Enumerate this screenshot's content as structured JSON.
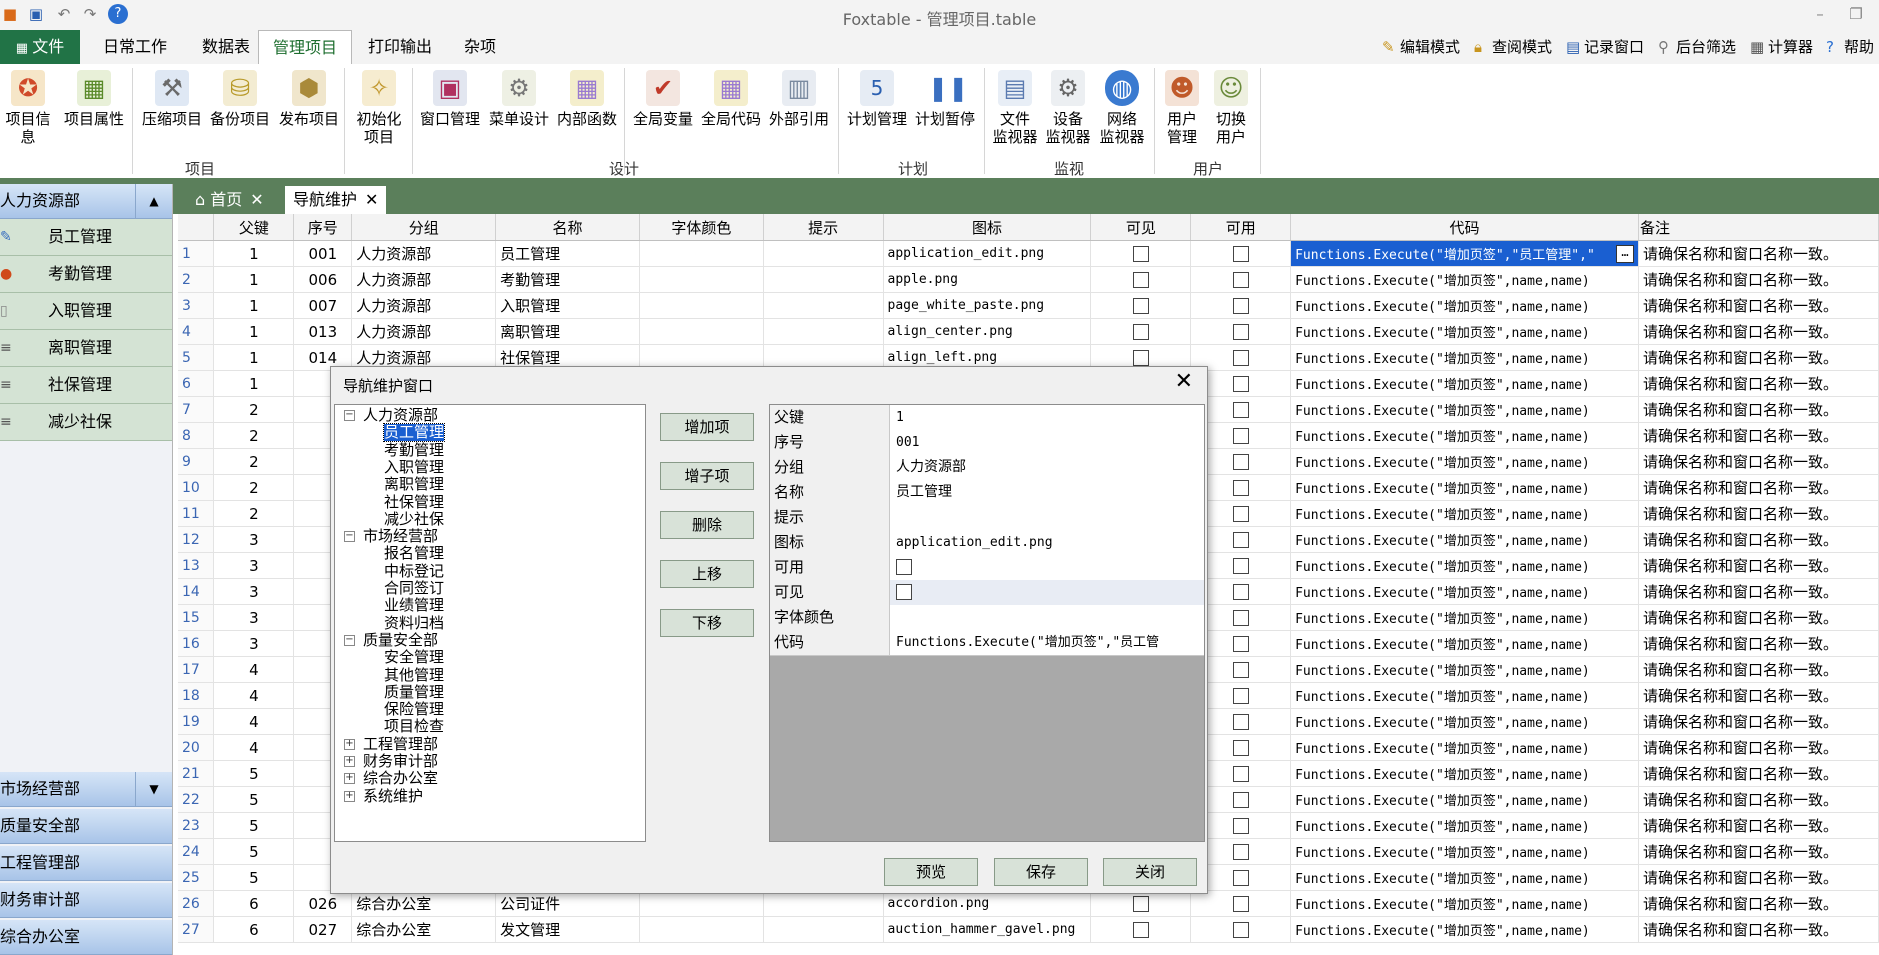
{
  "window": {
    "title": "Foxtable - 管理项目.table"
  },
  "ribbon_tabs": [
    {
      "label": "文件"
    },
    {
      "label": "日常工作"
    },
    {
      "label": "数据表"
    },
    {
      "label": "管理项目"
    },
    {
      "label": "打印输出"
    },
    {
      "label": "杂项"
    }
  ],
  "right_links": [
    {
      "label": "编辑模式",
      "icon": "pencil-icon"
    },
    {
      "label": "查阅模式",
      "icon": "lock-icon"
    },
    {
      "label": "记录窗口",
      "icon": "window-icon"
    },
    {
      "label": "后台筛选",
      "icon": "filter-icon"
    },
    {
      "label": "计算器",
      "icon": "calculator-icon"
    },
    {
      "label": "帮助",
      "icon": "help-icon"
    }
  ],
  "ribbon_groups": {
    "project": {
      "label": "项目",
      "buttons": [
        {
          "label": "项目信息"
        },
        {
          "label": "项目属性"
        },
        {
          "label": "压缩项目"
        },
        {
          "label": "备份项目"
        },
        {
          "label": "发布项目"
        },
        {
          "label1": "初始化",
          "label2": "项目"
        }
      ]
    },
    "design": {
      "label": "设计",
      "buttons": [
        {
          "label": "窗口管理"
        },
        {
          "label": "菜单设计"
        },
        {
          "label": "内部函数"
        },
        {
          "label": "全局变量"
        },
        {
          "label": "全局代码"
        },
        {
          "label": "外部引用"
        }
      ]
    },
    "plan": {
      "label": "计划",
      "buttons": [
        {
          "label": "计划管理"
        },
        {
          "label": "计划暂停"
        }
      ]
    },
    "monitor": {
      "label": "监视",
      "buttons": [
        {
          "label1": "文件",
          "label2": "监视器"
        },
        {
          "label1": "设备",
          "label2": "监视器"
        },
        {
          "label1": "网络",
          "label2": "监视器"
        }
      ]
    },
    "user": {
      "label": "用户",
      "buttons": [
        {
          "label1": "用户",
          "label2": "管理"
        },
        {
          "label1": "切换",
          "label2": "用户"
        }
      ]
    }
  },
  "left_nav": {
    "groups": [
      "人力资源部",
      "市场经营部",
      "质量安全部",
      "工程管理部",
      "财务审计部",
      "综合办公室"
    ],
    "items": [
      "员工管理",
      "考勤管理",
      "入职管理",
      "离职管理",
      "社保管理",
      "减少社保"
    ]
  },
  "doc_tabs": [
    {
      "label": "首页"
    },
    {
      "label": "导航维护"
    }
  ],
  "grid": {
    "columns": [
      "父键",
      "序号",
      "分组",
      "名称",
      "字体颜色",
      "提示",
      "图标",
      "可见",
      "可用",
      "代码",
      "备注"
    ],
    "selected_code": "Functions.Execute(\"增加页签\",\"员工管理\",\"",
    "default_code": "Functions.Execute(\"增加页签\",name,name)",
    "note": "请确保名称和窗口名称一致。",
    "rows": [
      {
        "n": "1",
        "pk": "1",
        "seq": "001",
        "group": "人力资源部",
        "name": "员工管理",
        "icon": "application_edit.png"
      },
      {
        "n": "2",
        "pk": "1",
        "seq": "006",
        "group": "人力资源部",
        "name": "考勤管理",
        "icon": "apple.png"
      },
      {
        "n": "3",
        "pk": "1",
        "seq": "007",
        "group": "人力资源部",
        "name": "入职管理",
        "icon": "page_white_paste.png"
      },
      {
        "n": "4",
        "pk": "1",
        "seq": "013",
        "group": "人力资源部",
        "name": "离职管理",
        "icon": "align_center.png"
      },
      {
        "n": "5",
        "pk": "1",
        "seq": "014",
        "group": "人力资源部",
        "name": "社保管理",
        "icon": "align_left.png"
      },
      {
        "n": "6",
        "pk": "1",
        "seq": "",
        "group": "",
        "name": "",
        "icon": ""
      },
      {
        "n": "7",
        "pk": "2",
        "seq": "",
        "group": "",
        "name": "",
        "icon": ""
      },
      {
        "n": "8",
        "pk": "2",
        "seq": "",
        "group": "",
        "name": "",
        "icon": ""
      },
      {
        "n": "9",
        "pk": "2",
        "seq": "",
        "group": "",
        "name": "",
        "icon": ""
      },
      {
        "n": "10",
        "pk": "2",
        "seq": "",
        "group": "",
        "name": "",
        "icon": ""
      },
      {
        "n": "11",
        "pk": "2",
        "seq": "",
        "group": "",
        "name": "",
        "icon": ""
      },
      {
        "n": "12",
        "pk": "3",
        "seq": "",
        "group": "",
        "name": "",
        "icon": ""
      },
      {
        "n": "13",
        "pk": "3",
        "seq": "",
        "group": "",
        "name": "",
        "icon": ""
      },
      {
        "n": "14",
        "pk": "3",
        "seq": "",
        "group": "",
        "name": "",
        "icon": ""
      },
      {
        "n": "15",
        "pk": "3",
        "seq": "",
        "group": "",
        "name": "",
        "icon": ""
      },
      {
        "n": "16",
        "pk": "3",
        "seq": "",
        "group": "",
        "name": "",
        "icon": ""
      },
      {
        "n": "17",
        "pk": "4",
        "seq": "",
        "group": "",
        "name": "",
        "icon": ""
      },
      {
        "n": "18",
        "pk": "4",
        "seq": "",
        "group": "",
        "name": "",
        "icon": ""
      },
      {
        "n": "19",
        "pk": "4",
        "seq": "",
        "group": "",
        "name": "",
        "icon": ""
      },
      {
        "n": "20",
        "pk": "4",
        "seq": "",
        "group": "",
        "name": "",
        "icon": ""
      },
      {
        "n": "21",
        "pk": "5",
        "seq": "",
        "group": "",
        "name": "",
        "icon": ""
      },
      {
        "n": "22",
        "pk": "5",
        "seq": "",
        "group": "",
        "name": "",
        "icon": ""
      },
      {
        "n": "23",
        "pk": "5",
        "seq": "",
        "group": "",
        "name": "",
        "icon": ""
      },
      {
        "n": "24",
        "pk": "5",
        "seq": "",
        "group": "",
        "name": "",
        "icon": ""
      },
      {
        "n": "25",
        "pk": "5",
        "seq": "",
        "group": "",
        "name": "",
        "icon": ""
      },
      {
        "n": "26",
        "pk": "6",
        "seq": "026",
        "group": "综合办公室",
        "name": "公司证件",
        "icon": "accordion.png"
      },
      {
        "n": "27",
        "pk": "6",
        "seq": "027",
        "group": "综合办公室",
        "name": "发文管理",
        "icon": "auction_hammer_gavel.png"
      }
    ]
  },
  "dialog": {
    "title": "导航维护窗口",
    "buttons": [
      "增加项",
      "增子项",
      "删除",
      "上移",
      "下移"
    ],
    "footer": [
      "预览",
      "保存",
      "关闭"
    ],
    "tree": [
      {
        "label": "人力资源部",
        "level": 0,
        "expanded": true
      },
      {
        "label": "员工管理",
        "level": 1,
        "selected": true
      },
      {
        "label": "考勤管理",
        "level": 1
      },
      {
        "label": "入职管理",
        "level": 1
      },
      {
        "label": "离职管理",
        "level": 1
      },
      {
        "label": "社保管理",
        "level": 1
      },
      {
        "label": "减少社保",
        "level": 1
      },
      {
        "label": "市场经营部",
        "level": 0,
        "expanded": true
      },
      {
        "label": "报名管理",
        "level": 1
      },
      {
        "label": "中标登记",
        "level": 1
      },
      {
        "label": "合同签订",
        "level": 1
      },
      {
        "label": "业绩管理",
        "level": 1
      },
      {
        "label": "资料归档",
        "level": 1
      },
      {
        "label": "质量安全部",
        "level": 0,
        "expanded": true
      },
      {
        "label": "安全管理",
        "level": 1
      },
      {
        "label": "其他管理",
        "level": 1
      },
      {
        "label": "质量管理",
        "level": 1
      },
      {
        "label": "保险管理",
        "level": 1
      },
      {
        "label": "项目检查",
        "level": 1
      },
      {
        "label": "工程管理部",
        "level": 0,
        "expanded": false
      },
      {
        "label": "财务审计部",
        "level": 0,
        "expanded": false
      },
      {
        "label": "综合办公室",
        "level": 0,
        "expanded": false
      },
      {
        "label": "系统维护",
        "level": 0,
        "expanded": false
      }
    ],
    "props": [
      {
        "name": "父键",
        "value": "1"
      },
      {
        "name": "序号",
        "value": "001"
      },
      {
        "name": "分组",
        "value": "人力资源部"
      },
      {
        "name": "名称",
        "value": "员工管理"
      },
      {
        "name": "提示",
        "value": ""
      },
      {
        "name": "图标",
        "value": "application_edit.png"
      },
      {
        "name": "可用",
        "value": ""
      },
      {
        "name": "可见",
        "value": ""
      },
      {
        "name": "字体颜色",
        "value": ""
      },
      {
        "name": "代码",
        "value": "Functions.Execute(\"增加页签\",\"员工管"
      }
    ]
  }
}
